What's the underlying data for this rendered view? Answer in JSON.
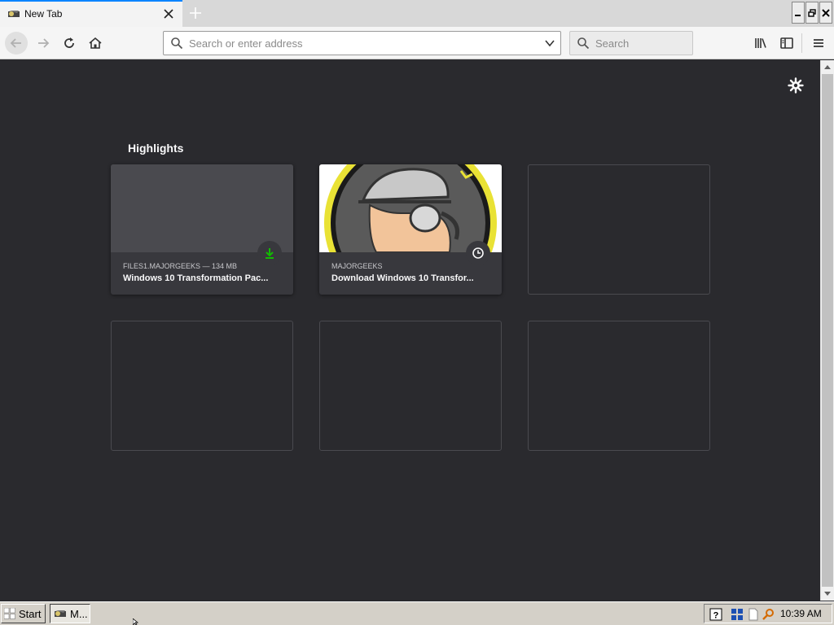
{
  "tabs": [
    {
      "title": "New Tab",
      "favicon": "majorgeeks-favicon"
    }
  ],
  "toolbar": {
    "url_placeholder": "Search or enter address",
    "search_placeholder": "Search"
  },
  "newtab": {
    "section_title": "Highlights",
    "cards": [
      {
        "context": "FILES1.MAJORGEEKS — 134 MB",
        "title": "Windows 10 Transformation Pac...",
        "badge": "download-icon"
      },
      {
        "context": "MAJORGEEKS",
        "title": "Download Windows 10 Transfor...",
        "badge": "clock-icon"
      }
    ]
  },
  "taskbar": {
    "start_label": "Start",
    "task_label": "M...",
    "clock": "10:39 AM"
  },
  "colors": {
    "accent": "#0a84ff",
    "newtab_background": "#2a2a2e",
    "card_background": "#38383d",
    "download_badge": "#12bc00"
  }
}
